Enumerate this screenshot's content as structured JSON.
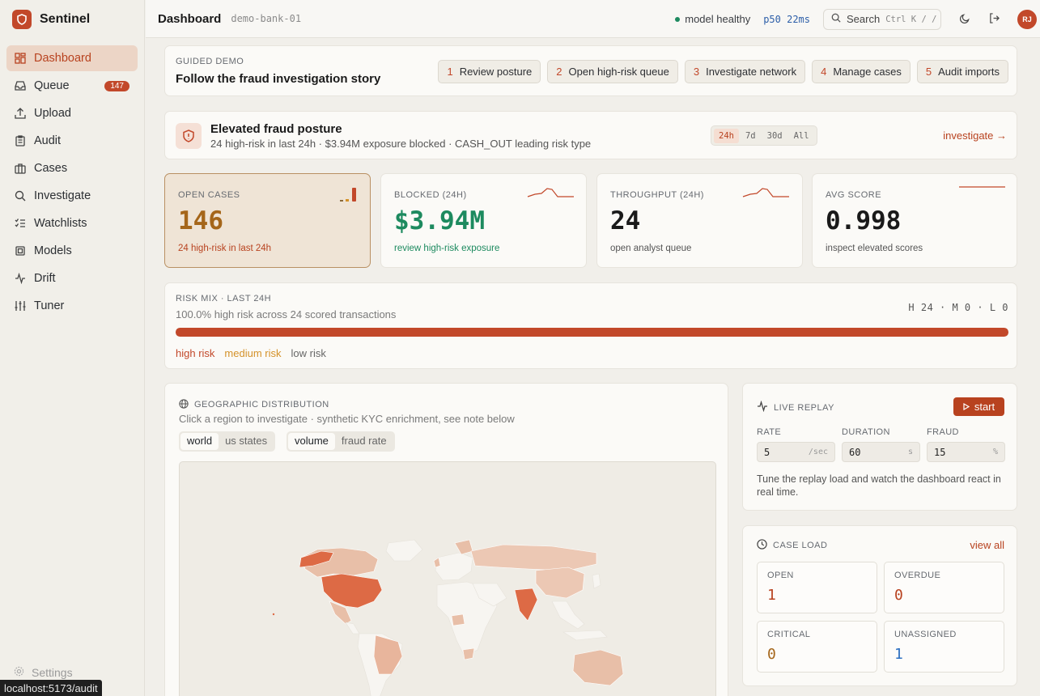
{
  "app": {
    "name": "Sentinel"
  },
  "sidebar": {
    "items": [
      {
        "label": "Dashboard",
        "icon": "dashboard-icon"
      },
      {
        "label": "Queue",
        "icon": "inbox-icon",
        "badge": "147"
      },
      {
        "label": "Upload",
        "icon": "upload-icon"
      },
      {
        "label": "Audit",
        "icon": "clipboard-icon"
      },
      {
        "label": "Cases",
        "icon": "briefcase-icon"
      },
      {
        "label": "Investigate",
        "icon": "search-icon"
      },
      {
        "label": "Watchlists",
        "icon": "list-check-icon"
      },
      {
        "label": "Models",
        "icon": "cpu-icon"
      },
      {
        "label": "Drift",
        "icon": "activity-icon"
      },
      {
        "label": "Tuner",
        "icon": "sliders-icon"
      }
    ],
    "settings": "Settings"
  },
  "status_url": "localhost:5173/audit",
  "topbar": {
    "title": "Dashboard",
    "tenant": "demo-bank-01",
    "health": "model healthy",
    "latency": "p50 22ms",
    "search_label": "Search",
    "search_kbd": "Ctrl K / /",
    "avatar": "RJ"
  },
  "guided_demo": {
    "eyebrow": "GUIDED DEMO",
    "title": "Follow the fraud investigation story",
    "steps": [
      {
        "n": "1",
        "label": "Review posture"
      },
      {
        "n": "2",
        "label": "Open high-risk queue"
      },
      {
        "n": "3",
        "label": "Investigate network"
      },
      {
        "n": "4",
        "label": "Manage cases"
      },
      {
        "n": "5",
        "label": "Audit imports"
      }
    ]
  },
  "posture": {
    "title": "Elevated fraud posture",
    "subtitle": "24 high-risk in last 24h · $3.94M exposure blocked · CASH_OUT leading risk type",
    "ranges": [
      "24h",
      "7d",
      "30d",
      "All"
    ],
    "selected_range": "24h",
    "link": "investigate →"
  },
  "kpis": [
    {
      "label": "OPEN CASES",
      "value": "146",
      "sub": "24 high-risk in last 24h",
      "color": "#a5661a",
      "sub_color": "#b8421f"
    },
    {
      "label": "BLOCKED (24H)",
      "value": "$3.94M",
      "sub": "review high-risk exposure",
      "color": "#1d8a5f",
      "sub_color": "#1d8a5f"
    },
    {
      "label": "THROUGHPUT (24H)",
      "value": "24",
      "sub": "open analyst queue",
      "color": "#1a1a1a",
      "sub_color": "#555555"
    },
    {
      "label": "AVG SCORE",
      "value": "0.998",
      "sub": "inspect elevated scores",
      "color": "#1a1a1a",
      "sub_color": "#555555"
    }
  ],
  "risk_mix": {
    "eyebrow": "RISK MIX · LAST 24H",
    "subtitle": "100.0% high risk across 24 scored transactions",
    "counts": "H 24 · M 0 · L 0",
    "high_fraction": 1.0,
    "legend": [
      {
        "label": "high risk",
        "color": "#c2482a"
      },
      {
        "label": "medium risk",
        "color": "#d4922a"
      },
      {
        "label": "low risk",
        "color": "#666666"
      }
    ]
  },
  "geo": {
    "eyebrow": "GEOGRAPHIC DISTRIBUTION",
    "subtitle": "Click a region to investigate · synthetic KYC enrichment, see note below",
    "scope_options": [
      "world",
      "us states"
    ],
    "scope_selected": "world",
    "metric_options": [
      "volume",
      "fraud rate"
    ],
    "metric_selected": "volume"
  },
  "replay": {
    "title": "LIVE REPLAY",
    "start": "start",
    "fields": [
      {
        "label": "RATE",
        "value": "5",
        "unit": "/sec"
      },
      {
        "label": "DURATION",
        "value": "60",
        "unit": "s"
      },
      {
        "label": "FRAUD",
        "value": "15",
        "unit": "%"
      }
    ],
    "note": "Tune the replay load and watch the dashboard react in real time."
  },
  "case_load": {
    "title": "CASE LOAD",
    "link": "view all",
    "boxes": [
      {
        "label": "OPEN",
        "value": "1",
        "color": "#b8421f"
      },
      {
        "label": "OVERDUE",
        "value": "0",
        "color": "#b8421f"
      },
      {
        "label": "CRITICAL",
        "value": "0",
        "color": "#a5661a"
      },
      {
        "label": "UNASSIGNED",
        "value": "1",
        "color": "#2c6fc1"
      }
    ]
  }
}
